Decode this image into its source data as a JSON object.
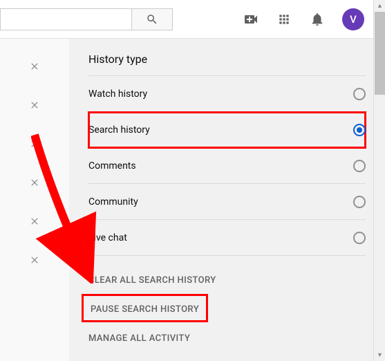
{
  "header": {
    "search_placeholder": "",
    "avatar_letter": "V"
  },
  "panel": {
    "title": "History type",
    "options": [
      {
        "label": "Watch history",
        "selected": false
      },
      {
        "label": "Search history",
        "selected": true
      },
      {
        "label": "Comments",
        "selected": false
      },
      {
        "label": "Community",
        "selected": false
      },
      {
        "label": "Live chat",
        "selected": false
      }
    ],
    "actions": {
      "clear": "CLEAR ALL SEARCH HISTORY",
      "pause": "PAUSE SEARCH HISTORY",
      "manage": "MANAGE ALL ACTIVITY"
    }
  }
}
